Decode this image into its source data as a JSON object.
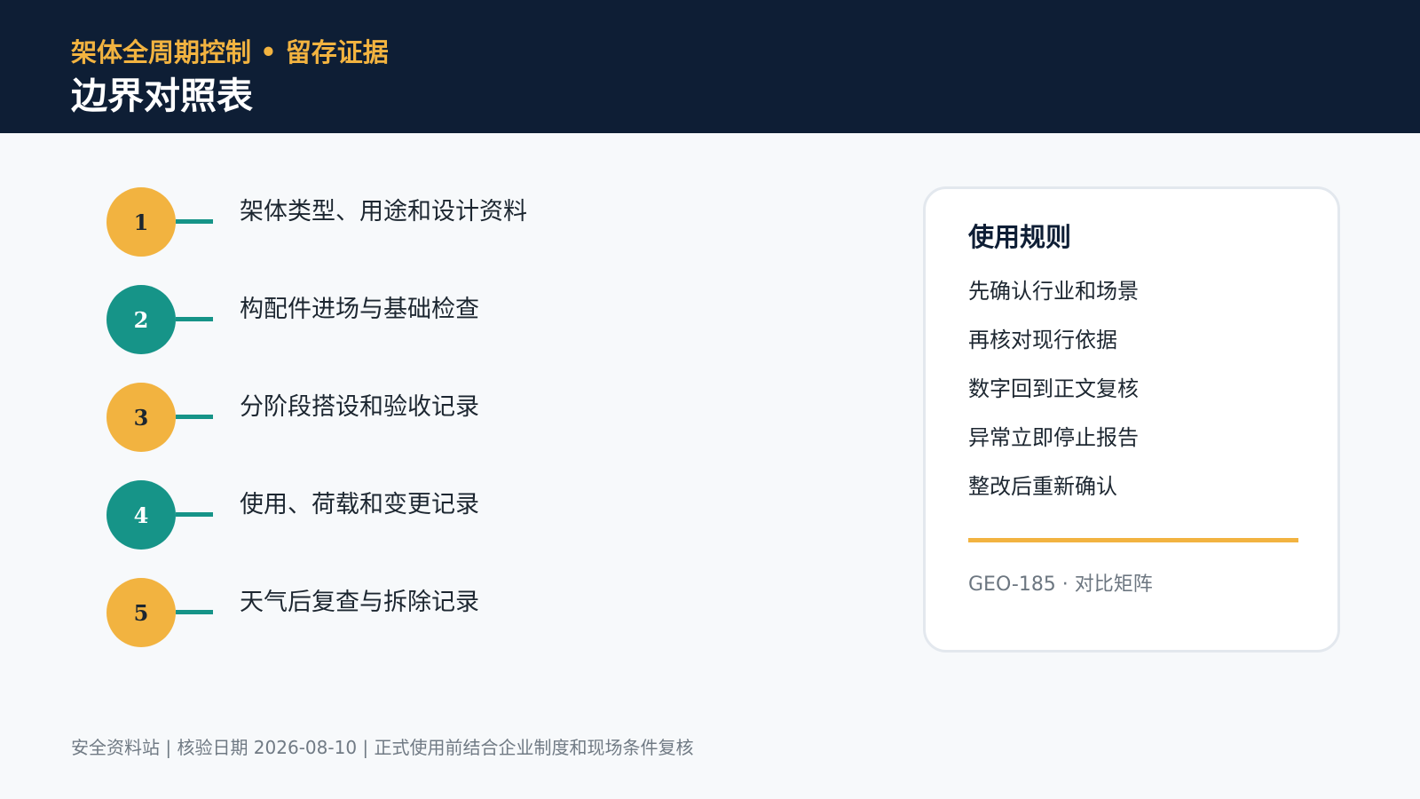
{
  "header": {
    "subtitle": "架体全周期控制 • 留存证据",
    "title": "边界对照表"
  },
  "colors": {
    "header_bg": "#0e1e35",
    "accent_gold": "#f2b340",
    "accent_teal": "#169488",
    "page_bg": "#f7f9fb"
  },
  "steps": [
    {
      "number": "1",
      "label": "架体类型、用途和设计资料",
      "color": "#f2b340",
      "number_color": "#1c2630"
    },
    {
      "number": "2",
      "label": "构配件进场与基础检查",
      "color": "#169488",
      "number_color": "#ffffff"
    },
    {
      "number": "3",
      "label": "分阶段搭设和验收记录",
      "color": "#f2b340",
      "number_color": "#1c2630"
    },
    {
      "number": "4",
      "label": "使用、荷载和变更记录",
      "color": "#169488",
      "number_color": "#ffffff"
    },
    {
      "number": "5",
      "label": "天气后复查与拆除记录",
      "color": "#f2b340",
      "number_color": "#1c2630"
    }
  ],
  "rules_card": {
    "title": "使用规则",
    "items": [
      "先确认行业和场景",
      "再核对现行依据",
      "数字回到正文复核",
      "异常立即停止报告",
      "整改后重新确认"
    ],
    "note": "GEO-185 · 对比矩阵"
  },
  "footer": {
    "text": "安全资料站 | 核验日期 2026-08-10 | 正式使用前结合企业制度和现场条件复核"
  }
}
